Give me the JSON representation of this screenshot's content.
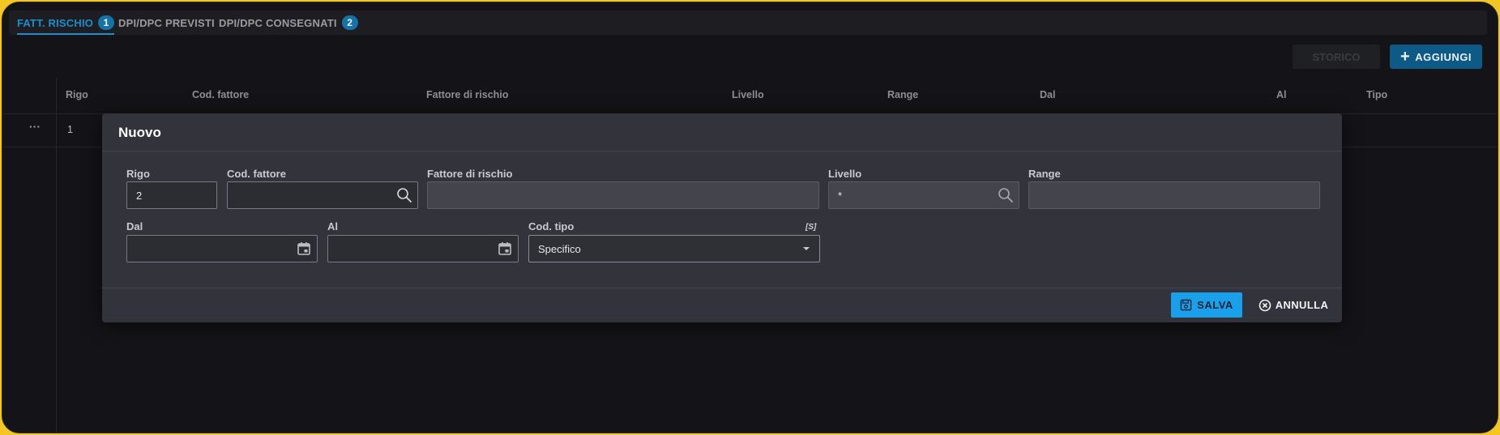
{
  "tabs": [
    {
      "label": "FATT. RISCHIO",
      "badge": "1"
    },
    {
      "label": "DPI/DPC PREVISTI"
    },
    {
      "label": "DPI/DPC CONSEGNATI",
      "badge": "2"
    }
  ],
  "toolbar": {
    "disabled_label": "STORICO",
    "add_label": "AGGIUNGI"
  },
  "grid": {
    "columns": [
      "Rigo",
      "Cod. fattore",
      "Fattore di rischio",
      "Livello",
      "Range",
      "Dal",
      "Al",
      "Tipo"
    ],
    "rows": [
      {
        "actions": "···",
        "rigo": "1"
      }
    ]
  },
  "modal": {
    "title": "Nuovo",
    "fields": {
      "rigo": {
        "label": "Rigo",
        "value": "2"
      },
      "cod_fattore": {
        "label": "Cod. fattore",
        "value": ""
      },
      "fattore_rischio": {
        "label": "Fattore di rischio",
        "value": ""
      },
      "livello": {
        "label": "Livello",
        "value": "*"
      },
      "range": {
        "label": "Range",
        "value": ""
      },
      "dal": {
        "label": "Dal",
        "value": ""
      },
      "al": {
        "label": "Al",
        "value": ""
      },
      "cod_tipo": {
        "label": "Cod. tipo",
        "value": "Specifico",
        "tag": "[S]"
      }
    },
    "save_label": "SALVA",
    "cancel_label": "ANNULLA"
  },
  "colors": {
    "accent": "#1aa0ea",
    "tab_active": "#1a8fd0",
    "background": "#141418",
    "modal": "#33333b",
    "frame": "#f3c623"
  },
  "icons": [
    "search-icon",
    "calendar-icon",
    "caret-down-icon",
    "plus-icon",
    "save-icon",
    "cancel-circle-icon"
  ]
}
